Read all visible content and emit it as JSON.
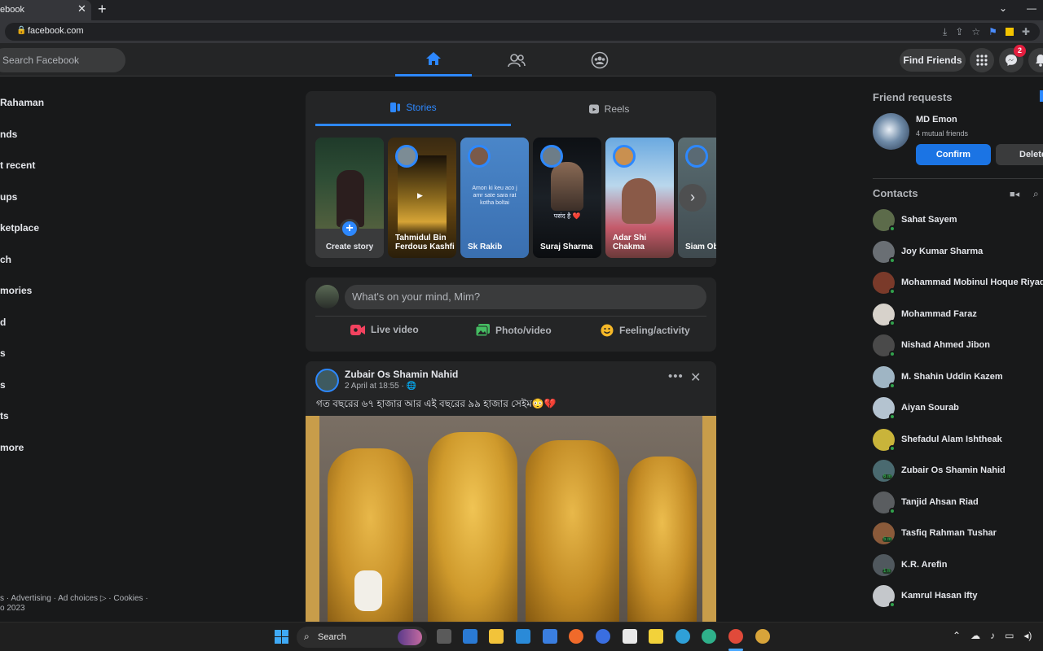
{
  "browser": {
    "tab_title": "ebook",
    "tab_close": "✕",
    "new_tab": "+",
    "url": "facebook.com"
  },
  "header": {
    "search_placeholder": "Search Facebook",
    "find_friends": "Find Friends",
    "messenger_badge": "2"
  },
  "left_nav": [
    "Rahaman",
    "nds",
    "t recent",
    "ups",
    "ketplace",
    "ch",
    "mories",
    "d",
    "s",
    "s",
    "ts",
    "more"
  ],
  "footer": {
    "line1": "s · Advertising · Ad choices ▷ · Cookies ·",
    "line2": "o 2023"
  },
  "stories": {
    "tab_stories": "Stories",
    "tab_reels": "Reels",
    "create_label": "Create story",
    "items": [
      {
        "name": "Tahmidul Bin Ferdous Kashfi"
      },
      {
        "name": "Sk Rakib",
        "text": "Amon ki keu aco j amr sate sara rat kotha boltai"
      },
      {
        "name": "Suraj Sharma",
        "text": "पसंद है ❤️"
      },
      {
        "name": "Adar Shi Chakma"
      },
      {
        "name": "Siam Ob"
      }
    ]
  },
  "composer": {
    "placeholder": "What's on your mind, Mim?",
    "live": "Live video",
    "photo": "Photo/video",
    "feeling": "Feeling/activity"
  },
  "post": {
    "author": "Zubair Os Shamin Nahid",
    "time": "2 April at 18:55 · ",
    "text": "গত বছরের ৬৭ হাজার আর এই বছরের ৯৯ হাজার সেইম😳💔"
  },
  "right": {
    "friend_requests_title": "Friend requests",
    "request_name": "MD Emon",
    "request_mutual": "4 mutual friends",
    "confirm": "Confirm",
    "delete": "Delete",
    "contacts_title": "Contacts",
    "contacts": [
      {
        "name": "Sahat Sayem",
        "color": "#5c6b4a"
      },
      {
        "name": "Joy Kumar Sharma",
        "color": "#6a6f74"
      },
      {
        "name": "Mohammad Mobinul Hoque Riyad",
        "color": "#7a3a2a"
      },
      {
        "name": "Mohammad Faraz",
        "color": "#d7d2cb"
      },
      {
        "name": "Nishad Ahmed Jibon",
        "color": "#4a4a4a"
      },
      {
        "name": "M. Shahin Uddin Kazem",
        "color": "#9fb5c4"
      },
      {
        "name": "Aiyan Sourab",
        "color": "#b4c3d0"
      },
      {
        "name": "Shefadul Alam Ishtheak",
        "color": "#c9b43a"
      },
      {
        "name": "Zubair Os Shamin Nahid",
        "color": "#4a6a70",
        "mins": "6 m"
      },
      {
        "name": "Tanjid Ahsan Riad",
        "color": "#5a5d60"
      },
      {
        "name": "Tasfiq Rahman Tushar",
        "color": "#8a5a3a",
        "mins": "5 m"
      },
      {
        "name": "K.R. Arefin",
        "color": "#50585e",
        "mins": "1 h"
      },
      {
        "name": "Kamrul Hasan Ifty",
        "color": "#c4c7cb"
      }
    ]
  },
  "taskbar": {
    "search": "Search"
  },
  "colors": {
    "accent": "#2d88ff",
    "confirm": "#1b74e4",
    "online": "#31a24c"
  }
}
